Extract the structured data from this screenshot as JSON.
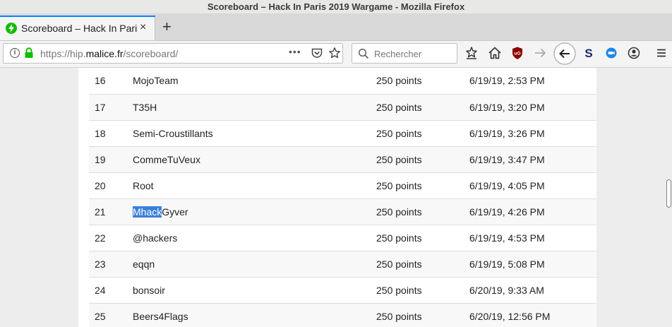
{
  "window": {
    "title": "Scoreboard – Hack In Paris 2019 Wargame - Mozilla Firefox"
  },
  "tab": {
    "title": "Scoreboard – Hack In Paris 2019 Wargame",
    "close_glyph": "×",
    "new_glyph": "+"
  },
  "urlbar": {
    "scheme": "https://hip.",
    "domain": "malice.fr",
    "path": "/scoreboard/",
    "info_glyph": "i",
    "more_glyph": "•••"
  },
  "search": {
    "placeholder": "Rechercher"
  },
  "colors": {
    "accent": "#0a84ff",
    "selection": "#3a80d8",
    "lock": "#12bc00"
  },
  "scoreboard": {
    "selected_text": "Mhack",
    "rows": [
      {
        "rank": "16",
        "team": "MojoTeam",
        "points": "250 points",
        "time": "6/19/19, 2:53 PM"
      },
      {
        "rank": "17",
        "team": "T35H",
        "points": "250 points",
        "time": "6/19/19, 3:20 PM"
      },
      {
        "rank": "18",
        "team": "Semi-Croustillants",
        "points": "250 points",
        "time": "6/19/19, 3:26 PM"
      },
      {
        "rank": "19",
        "team": "CommeTuVeux",
        "points": "250 points",
        "time": "6/19/19, 3:47 PM"
      },
      {
        "rank": "20",
        "team": "Root",
        "points": "250 points",
        "time": "6/19/19, 4:05 PM"
      },
      {
        "rank": "21",
        "team": "MhackGyver",
        "team_selected": "Mhack",
        "team_rest": "Gyver",
        "points": "250 points",
        "time": "6/19/19, 4:26 PM"
      },
      {
        "rank": "22",
        "team": "@hackers",
        "points": "250 points",
        "time": "6/19/19, 4:53 PM"
      },
      {
        "rank": "23",
        "team": "eqqn",
        "points": "250 points",
        "time": "6/19/19, 5:08 PM"
      },
      {
        "rank": "24",
        "team": "bonsoir",
        "points": "250 points",
        "time": "6/20/19, 9:33 AM"
      },
      {
        "rank": "25",
        "team": "Beers4Flags",
        "points": "250 points",
        "time": "6/20/19, 12:56 PM"
      }
    ]
  }
}
